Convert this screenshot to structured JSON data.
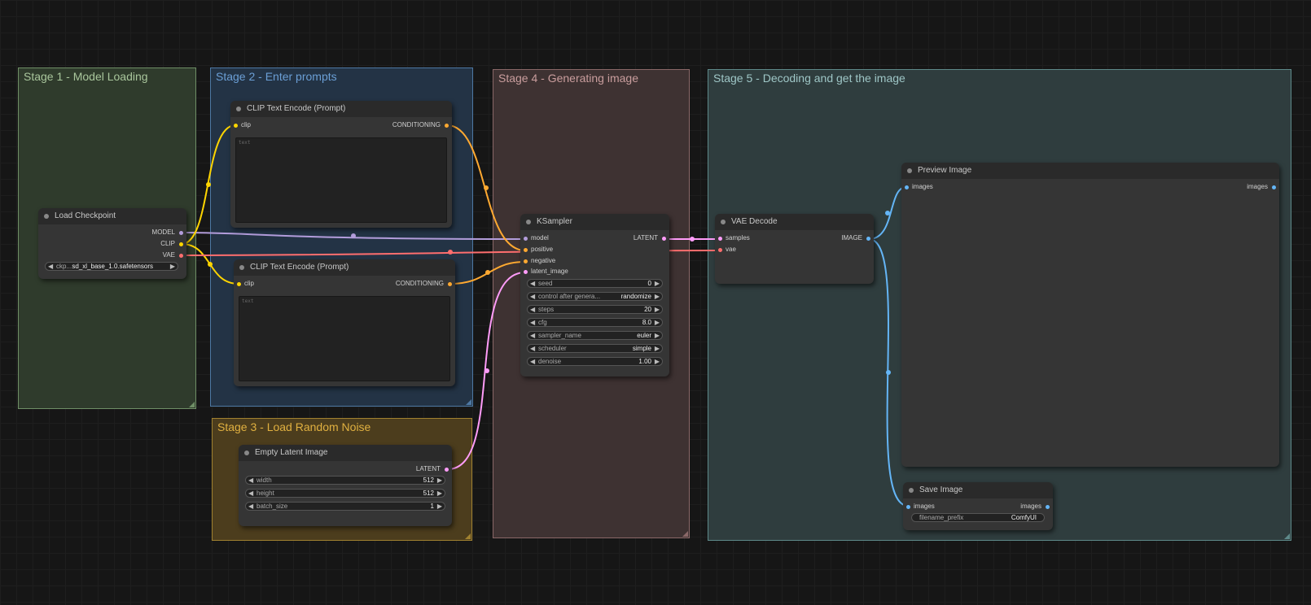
{
  "colors": {
    "model": "#b39ddb",
    "clip": "#ffd500",
    "vae": "#ff6e6e",
    "conditioning": "#ffa931",
    "latent": "#ff9cf9",
    "image": "#64b5f6"
  },
  "groups": {
    "stage1": "Stage 1 - Model Loading",
    "stage2": "Stage 2 - Enter prompts",
    "stage3": "Stage 3 - Load Random Noise",
    "stage4": "Stage 4 - Generating image",
    "stage5": "Stage 5 - Decoding and get the image"
  },
  "load_checkpoint": {
    "title": "Load Checkpoint",
    "outputs": [
      "MODEL",
      "CLIP",
      "VAE"
    ],
    "ckpt_label": "ckp...",
    "ckpt_value": "sd_xl_base_1.0.safetensors"
  },
  "clip_pos": {
    "title": "CLIP Text Encode (Prompt)",
    "input": "clip",
    "output": "CONDITIONING",
    "placeholder": "text"
  },
  "clip_neg": {
    "title": "CLIP Text Encode (Prompt)",
    "input": "clip",
    "output": "CONDITIONING",
    "placeholder": "text"
  },
  "empty_latent": {
    "title": "Empty Latent Image",
    "output": "LATENT",
    "widgets": [
      {
        "label": "width",
        "value": "512"
      },
      {
        "label": "height",
        "value": "512"
      },
      {
        "label": "batch_size",
        "value": "1"
      }
    ]
  },
  "ksampler": {
    "title": "KSampler",
    "inputs": [
      "model",
      "positive",
      "negative",
      "latent_image"
    ],
    "output": "LATENT",
    "widgets": [
      {
        "label": "seed",
        "value": "0"
      },
      {
        "label": "control after genera...",
        "value": "randomize"
      },
      {
        "label": "steps",
        "value": "20"
      },
      {
        "label": "cfg",
        "value": "8.0"
      },
      {
        "label": "sampler_name",
        "value": "euler"
      },
      {
        "label": "scheduler",
        "value": "simple"
      },
      {
        "label": "denoise",
        "value": "1.00"
      }
    ]
  },
  "vae_decode": {
    "title": "VAE Decode",
    "inputs": [
      "samples",
      "vae"
    ],
    "output": "IMAGE"
  },
  "preview_image": {
    "title": "Preview Image",
    "input": "images",
    "output": "images"
  },
  "save_image": {
    "title": "Save Image",
    "input": "images",
    "output": "images",
    "widget": {
      "label": "filename_prefix",
      "value": "ComfyUI"
    }
  }
}
